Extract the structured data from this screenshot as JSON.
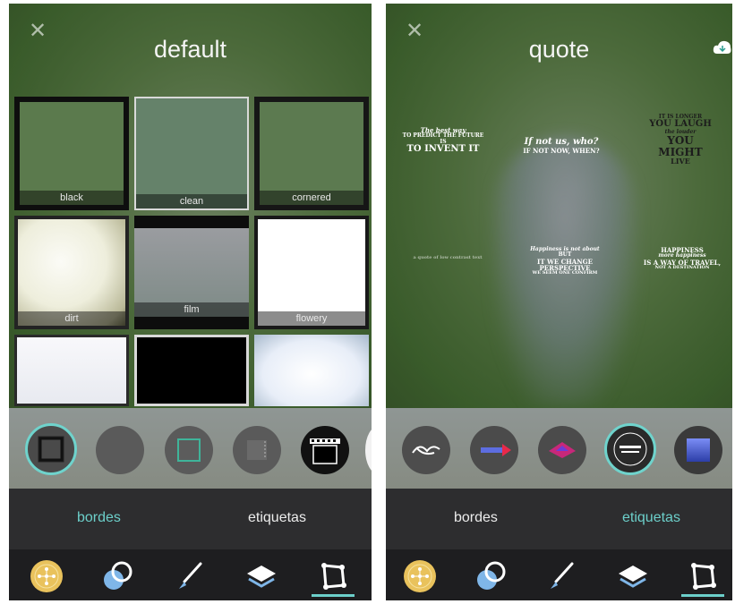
{
  "left_screen": {
    "title": "default",
    "close_icon": "close-icon",
    "tiles": [
      {
        "label": "black"
      },
      {
        "label": "clean"
      },
      {
        "label": "cornered"
      },
      {
        "label": "dirt"
      },
      {
        "label": "film"
      },
      {
        "label": "flowery"
      },
      {
        "label": ""
      },
      {
        "label": ""
      },
      {
        "label": ""
      }
    ],
    "tabs": {
      "bordes": "bordes",
      "etiquetas": "etiquetas",
      "active": "bordes"
    }
  },
  "right_screen": {
    "title": "quote",
    "close_icon": "close-icon",
    "cloud_icon": "cloud-download-icon",
    "quotes": [
      {
        "lines": [
          "The best way",
          "TO PREDICT THE FUTURE",
          "IS",
          "TO INVENT IT"
        ]
      },
      {
        "lines": [
          "If not us, who?",
          "IF NOT NOW, WHEN?"
        ]
      },
      {
        "lines": [
          "IT IS LONGER",
          "YOU LAUGH",
          "the louder",
          "YOU MIGHT",
          "LIVE"
        ]
      },
      {
        "lines": [
          "a quote of low contrast text"
        ]
      },
      {
        "lines": [
          "Happiness is not about",
          "BUT",
          "IT WE CHANGE PERSPECTIVE",
          "WE SEEM ONE CONFIRM"
        ]
      },
      {
        "lines": [
          "HAPPINESS",
          "more happiness",
          "IS A WAY OF TRAVEL,",
          "NOT A DESTINATION"
        ]
      }
    ],
    "tabs": {
      "bordes": "bordes",
      "etiquetas": "etiquetas",
      "active": "etiquetas"
    }
  },
  "toolbar_icons": [
    "compass-icon",
    "circles-icon",
    "brush-icon",
    "layers-icon",
    "crop-frame-icon"
  ],
  "colors": {
    "accent": "#6ccfca",
    "tabbar": "#2d2d2f",
    "toolbar": "#1e1e20"
  }
}
